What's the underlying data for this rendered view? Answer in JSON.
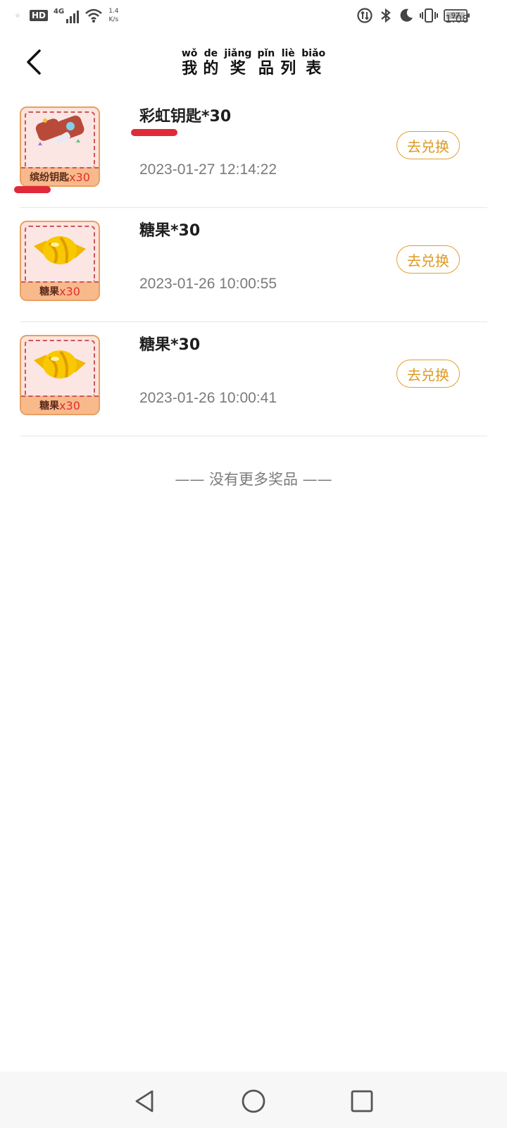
{
  "status_bar": {
    "hd": "HD",
    "network": "4G",
    "speed_value": "1.4",
    "speed_unit": "K/s",
    "battery": "97",
    "time": "1:08"
  },
  "header": {
    "title_chars": [
      {
        "pinyin": "wǒ",
        "hanzi": "我"
      },
      {
        "pinyin": "de",
        "hanzi": "的"
      },
      {
        "pinyin": "jiǎng",
        "hanzi": "奖"
      },
      {
        "pinyin": "pǐn",
        "hanzi": "品"
      },
      {
        "pinyin": "liè",
        "hanzi": "列"
      },
      {
        "pinyin": "biǎo",
        "hanzi": "表"
      }
    ]
  },
  "prizes": [
    {
      "name": "彩虹钥匙*30",
      "date": "2023-01-27 12:14:22",
      "thumb_name": "缤纷钥匙",
      "thumb_qty": "x30",
      "button": "去兑换",
      "icon": "key-icon"
    },
    {
      "name": "糖果*30",
      "date": "2023-01-26 10:00:55",
      "thumb_name": "糖果",
      "thumb_qty": "x30",
      "button": "去兑换",
      "icon": "candy-icon"
    },
    {
      "name": "糖果*30",
      "date": "2023-01-26 10:00:41",
      "thumb_name": "糖果",
      "thumb_qty": "x30",
      "button": "去兑换",
      "icon": "candy-icon"
    }
  ],
  "footer_note": "—— 没有更多奖品 ——",
  "colors": {
    "accent": "#dd9a22",
    "annotation": "#e02a3a",
    "thumb_bg": "#fde3dc"
  }
}
